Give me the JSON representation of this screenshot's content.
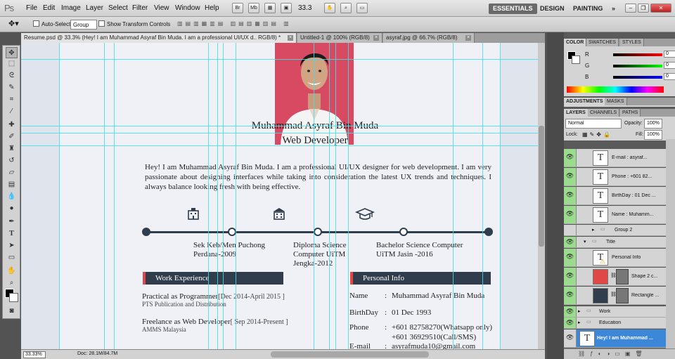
{
  "app": {
    "logo": "Ps"
  },
  "menu": [
    "File",
    "Edit",
    "Image",
    "Layer",
    "Select",
    "Filter",
    "View",
    "Window",
    "Help"
  ],
  "toolbar": {
    "zoom": "33.3",
    "workspaces": [
      "ESSENTIALS",
      "DESIGN",
      "PAINTING"
    ],
    "more": "»"
  },
  "options": {
    "auto_select": "Auto-Select:",
    "group_value": "Group",
    "show_transform": "Show Transform Controls"
  },
  "tabs": [
    {
      "label": "Resume.psd @ 33.3% (Hey! I am Muhammad Asyraf Bin Muda. I am a professional UI/UX d.. RGB/8) *"
    },
    {
      "label": "Untitled-1 @ 100% (RGB/8)"
    },
    {
      "label": "asyraf.jpg @ 66.7% (RGB/8)"
    }
  ],
  "document": {
    "name": "Muhammad Asyraf Bin Muda",
    "role": "Web Developer",
    "intro": "Hey! I am Muhammad Asyraf Bin Muda. I am a professional UI/UX designer for web development. I am very passionate about designing interfaces while taking into consideration the latest UX trends and techniques. I always balance looking fresh with being effective.",
    "education": [
      {
        "line1": "Sek Keb/Men Puchong",
        "line2": "Perdana-2009"
      },
      {
        "line1": "Diploma Science",
        "line2": "Computer UiTM",
        "line3": "Jengka-2012"
      },
      {
        "line1": "Bachelor Science Computer",
        "line2": "UiTM Jasin -2016"
      }
    ],
    "work_title": "Work Experience",
    "work": [
      {
        "title": "Practical as Programmer",
        "period": "[Dec 2014-April 2015 ]",
        "company": "PTS Publication and Distribution"
      },
      {
        "title": "Freelance as Web Developer",
        "period": "[ Sep 2014-Present ]",
        "company": "AMMS Malaysia"
      }
    ],
    "personal_title": "Personal Info",
    "personal": {
      "name_label": "Name",
      "name_value": "Muhammad Asyraf Bin Muda",
      "birthday_label": "BirthDay",
      "birthday_value": "01 Dec 1993",
      "phone_label": "Phone",
      "phone_value1": "+601 82758270(Whatsapp only)",
      "phone_value2": "+601 36929510(Call/SMS)",
      "email_label": "E-mail",
      "email_value": "asyrafmuda10@gmail.com",
      "sep": ":"
    }
  },
  "status": {
    "zoom": "33.33%",
    "doc": "Doc: 28.1M/84.7M"
  },
  "color_panel": {
    "tabs": [
      "COLOR",
      "SWATCHES",
      "STYLES"
    ],
    "r_label": "R",
    "g_label": "G",
    "b_label": "B",
    "r": "0",
    "g": "0",
    "b": "0"
  },
  "adjust_tabs": [
    "ADJUSTMENTS",
    "MASKS"
  ],
  "layers_panel": {
    "tabs": [
      "LAYERS",
      "CHANNELS",
      "PATHS"
    ],
    "blend": "Normal",
    "opacity_label": "Opacity:",
    "opacity": "100%",
    "lock_label": "Lock:",
    "fill_label": "Fill:",
    "fill": "100%",
    "layers": [
      {
        "type": "text",
        "name": "E-mail    :  asyraf..."
      },
      {
        "type": "text",
        "name": "Phone   :  +601 82..."
      },
      {
        "type": "text",
        "name": "BirthDay :  01 Dec ..."
      },
      {
        "type": "text",
        "name": "Name   :  Muhamm..."
      },
      {
        "type": "group",
        "name": "Group 2"
      },
      {
        "type": "group",
        "name": "Title"
      },
      {
        "type": "text",
        "name": "Personal Info"
      },
      {
        "type": "shape",
        "name": "Shape 2 c..."
      },
      {
        "type": "shape",
        "name": "Rectangle ..."
      },
      {
        "type": "group",
        "name": "Work"
      },
      {
        "type": "group",
        "name": "Education"
      },
      {
        "type": "text",
        "name": "Hey! I am Muhammad ..."
      }
    ]
  },
  "colors": {
    "accent_red": "#e04848",
    "section_dark": "#2f3d4d",
    "photo_bg": "#d84a61",
    "guide": "#40e0e8",
    "selection": "#3d87d8"
  }
}
